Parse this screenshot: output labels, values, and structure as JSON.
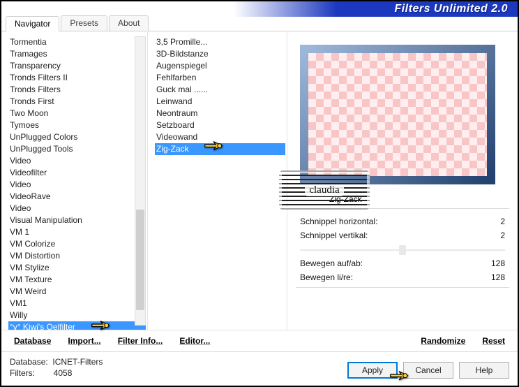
{
  "title": "Filters Unlimited 2.0",
  "tabs": [
    "Navigator",
    "Presets",
    "About"
  ],
  "active_tab": 0,
  "categories": [
    "Tormentia",
    "Tramages",
    "Transparency",
    "Tronds Filters II",
    "Tronds Filters",
    "Tronds First",
    "Two Moon",
    "Tymoes",
    "UnPlugged Colors",
    "UnPlugged Tools",
    "Video",
    "Videofilter",
    "Video",
    "VideoRave",
    "Video",
    "Visual Manipulation",
    "VM 1",
    "VM Colorize",
    "VM Distortion",
    "VM Stylize",
    "VM Texture",
    "VM Weird",
    "VM1",
    "Willy",
    "°v° Kiwi's Oelfilter"
  ],
  "selected_category_index": 24,
  "filters": [
    "3,5 Promille...",
    "3D-Bildstanze",
    "Augenspiegel",
    "Fehlfarben",
    "Guck mal ......",
    "Leinwand",
    "Neontraum",
    "Setzboard",
    "Videowand",
    "Zig-Zack"
  ],
  "selected_filter_index": 9,
  "preview_name": "Zig-Zack",
  "params": {
    "schnippel_h": {
      "label": "Schnippel horizontal:",
      "value": "2"
    },
    "schnippel_v": {
      "label": "Schnippel vertikal:",
      "value": "2"
    },
    "bewegen_ab": {
      "label": "Bewegen auf/ab:",
      "value": "128"
    },
    "bewegen_lr": {
      "label": "Bewegen li/re:",
      "value": "128"
    }
  },
  "cmd": {
    "database": "Database",
    "import": "Import...",
    "filter_info": "Filter Info...",
    "editor": "Editor...",
    "randomize": "Randomize",
    "reset": "Reset"
  },
  "footer": {
    "db_label": "Database:",
    "db_value": "ICNET-Filters",
    "filters_label": "Filters:",
    "filters_value": "4058",
    "apply": "Apply",
    "cancel": "Cancel",
    "help": "Help"
  },
  "stamp": "claudia",
  "colors": {
    "title_blue": "#1b38bf",
    "selection": "#3a97ff",
    "frame_dark": "#23426f"
  }
}
